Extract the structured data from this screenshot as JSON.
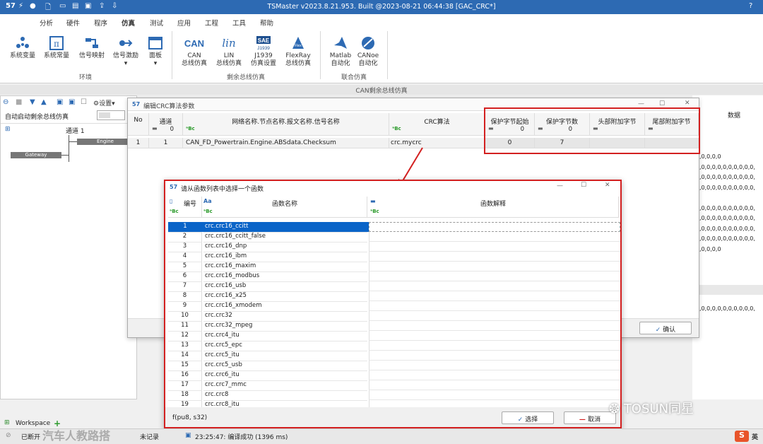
{
  "app": {
    "title": "TSMaster v2023.8.21.953. Built @2023-08-21 06:44:38 [GAC_CRC*]",
    "help": "?"
  },
  "menu": [
    "分析",
    "硬件",
    "程序",
    "仿真",
    "测试",
    "应用",
    "工程",
    "工具",
    "帮助"
  ],
  "ribbon": {
    "groups": [
      {
        "name": "环境"
      },
      {
        "name": "剩余总线仿真"
      },
      {
        "name": "联合仿真"
      }
    ],
    "buttons": [
      {
        "l1": "系统变量",
        "l2": ""
      },
      {
        "l1": "系统常量",
        "l2": ""
      },
      {
        "l1": "信号映射",
        "l2": ""
      },
      {
        "l1": "信号激励",
        "l2": "▾"
      },
      {
        "l1": "面板",
        "l2": "▾"
      },
      {
        "l1": "CAN",
        "l2": "总线仿真"
      },
      {
        "l1": "LIN",
        "l2": "总线仿真"
      },
      {
        "l1": "J1939",
        "l2": "仿真设置"
      },
      {
        "l1": "FlexRay",
        "l2": "总线仿真"
      },
      {
        "l1": "Matlab",
        "l2": "自动化"
      },
      {
        "l1": "CANoe",
        "l2": "自动化"
      }
    ]
  },
  "can_window": {
    "title": "CAN剩余总线仿真",
    "settings": "设置",
    "auto_start": "自动启动剩余总线仿真",
    "channel": "通道 1",
    "engine": "Engine",
    "gateway": "Gateway",
    "data_header": "数据",
    "data_rows": [
      ",0,0,0,0",
      ",0,0,0,0,0,0,0,0,0,0,",
      ",0,0,0,0,0,0,0,0,0,0,",
      ",0,0,0,0,0,0,0,0,0,0,",
      "",
      ",0,0,0,0,0,0,0,0,0,0,",
      ",0,0,0,0,0,0,0,0,0,0,",
      ",0,0,0,0,0,0,0,0,0,0,",
      ",0,0,0,0,0,0,0,0,0,0,",
      ",0,0,0,0"
    ],
    "bottom_row": ",0,0,0,0,0,0,0,0,0,0,"
  },
  "crc_dialog": {
    "title": "编辑CRC算法参数",
    "headers": {
      "no": "No",
      "channel": "通道",
      "path": "网络名称.节点名称.报文名称.信号名称",
      "algo": "CRC算法",
      "start": "保护字节起始",
      "count": "保护字节数",
      "head": "头部附加字节",
      "tail": "尾部附加字节"
    },
    "filters": {
      "channel": "0",
      "start": "0",
      "count": "0"
    },
    "row": {
      "no": "1",
      "channel": "1",
      "path": "CAN_FD_Powertrain.Engine.ABSdata.Checksum",
      "algo": "crc.mycrc",
      "start": "0",
      "count": "7",
      "head": "",
      "tail": ""
    },
    "ok": "确认"
  },
  "func_dialog": {
    "title": "请从函数列表中选择一个函数",
    "headers": {
      "num": "编号",
      "name": "函数名称",
      "desc": "函数解释"
    },
    "rows": [
      {
        "n": "1",
        "f": "crc.crc16_ccitt"
      },
      {
        "n": "2",
        "f": "crc.crc16_ccitt_false"
      },
      {
        "n": "3",
        "f": "crc.crc16_dnp"
      },
      {
        "n": "4",
        "f": "crc.crc16_ibm"
      },
      {
        "n": "5",
        "f": "crc.crc16_maxim"
      },
      {
        "n": "6",
        "f": "crc.crc16_modbus"
      },
      {
        "n": "7",
        "f": "crc.crc16_usb"
      },
      {
        "n": "8",
        "f": "crc.crc16_x25"
      },
      {
        "n": "9",
        "f": "crc.crc16_xmodem"
      },
      {
        "n": "10",
        "f": "crc.crc32"
      },
      {
        "n": "11",
        "f": "crc.crc32_mpeg"
      },
      {
        "n": "12",
        "f": "crc.crc4_itu"
      },
      {
        "n": "13",
        "f": "crc.crc5_epc"
      },
      {
        "n": "14",
        "f": "crc.crc5_itu"
      },
      {
        "n": "15",
        "f": "crc.crc5_usb"
      },
      {
        "n": "16",
        "f": "crc.crc6_itu"
      },
      {
        "n": "17",
        "f": "crc.crc7_mmc"
      },
      {
        "n": "18",
        "f": "crc.crc8"
      },
      {
        "n": "19",
        "f": "crc.crc8_itu"
      }
    ],
    "signature": "f(pu8, s32)",
    "select": "选择",
    "cancel": "取消"
  },
  "status": {
    "workspace": "Workspace",
    "disconnected": "已断开",
    "norecord": "未记录",
    "compile": "23:25:47: 编译成功 (1396 ms)"
  },
  "watermark": {
    "left": "汽车人教路搭",
    "right": "TOSUN同星",
    "ime": "英"
  },
  "colors": {
    "accent": "#2d6ab3",
    "highlight": "#d32020",
    "selected": "#0a64c8"
  }
}
